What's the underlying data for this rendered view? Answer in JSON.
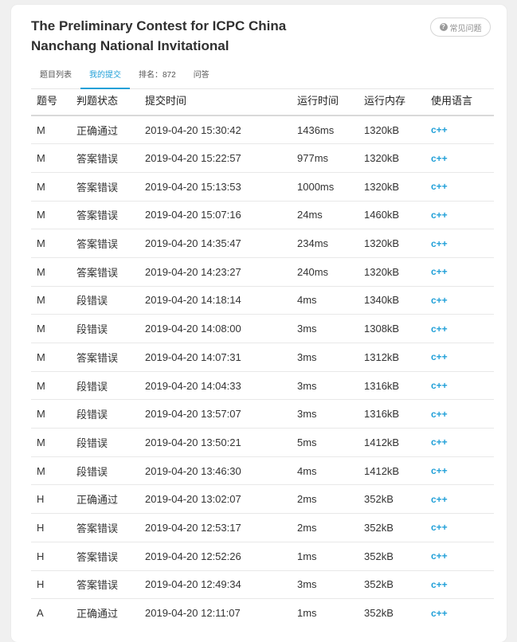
{
  "contest": {
    "title": "The Preliminary Contest for ICPC China Nanchang National Invitational",
    "faq_label": "常见问题",
    "faq_icon": "question-circle-icon"
  },
  "tabs": [
    {
      "label": "题目列表",
      "active": false
    },
    {
      "label": "我的提交",
      "active": true
    },
    {
      "label": "排名：872",
      "active": false
    },
    {
      "label": "问答",
      "active": false
    }
  ],
  "table": {
    "headers": [
      "题号",
      "判题状态",
      "提交时间",
      "运行时间",
      "运行内存",
      "使用语言"
    ],
    "rows": [
      [
        "M",
        "正确通过",
        "2019-04-20 15:30:42",
        "1436ms",
        "1320kB",
        "c++"
      ],
      [
        "M",
        "答案错误",
        "2019-04-20 15:22:57",
        "977ms",
        "1320kB",
        "c++"
      ],
      [
        "M",
        "答案错误",
        "2019-04-20 15:13:53",
        "1000ms",
        "1320kB",
        "c++"
      ],
      [
        "M",
        "答案错误",
        "2019-04-20 15:07:16",
        "24ms",
        "1460kB",
        "c++"
      ],
      [
        "M",
        "答案错误",
        "2019-04-20 14:35:47",
        "234ms",
        "1320kB",
        "c++"
      ],
      [
        "M",
        "答案错误",
        "2019-04-20 14:23:27",
        "240ms",
        "1320kB",
        "c++"
      ],
      [
        "M",
        "段错误",
        "2019-04-20 14:18:14",
        "4ms",
        "1340kB",
        "c++"
      ],
      [
        "M",
        "段错误",
        "2019-04-20 14:08:00",
        "3ms",
        "1308kB",
        "c++"
      ],
      [
        "M",
        "答案错误",
        "2019-04-20 14:07:31",
        "3ms",
        "1312kB",
        "c++"
      ],
      [
        "M",
        "段错误",
        "2019-04-20 14:04:33",
        "3ms",
        "1316kB",
        "c++"
      ],
      [
        "M",
        "段错误",
        "2019-04-20 13:57:07",
        "3ms",
        "1316kB",
        "c++"
      ],
      [
        "M",
        "段错误",
        "2019-04-20 13:50:21",
        "5ms",
        "1412kB",
        "c++"
      ],
      [
        "M",
        "段错误",
        "2019-04-20 13:46:30",
        "4ms",
        "1412kB",
        "c++"
      ],
      [
        "H",
        "正确通过",
        "2019-04-20 13:02:07",
        "2ms",
        "352kB",
        "c++"
      ],
      [
        "H",
        "答案错误",
        "2019-04-20 12:53:17",
        "2ms",
        "352kB",
        "c++"
      ],
      [
        "H",
        "答案错误",
        "2019-04-20 12:52:26",
        "1ms",
        "352kB",
        "c++"
      ],
      [
        "H",
        "答案错误",
        "2019-04-20 12:49:34",
        "3ms",
        "352kB",
        "c++"
      ],
      [
        "A",
        "正确通过",
        "2019-04-20 12:11:07",
        "1ms",
        "352kB",
        "c++"
      ]
    ]
  },
  "colors": {
    "accent": "#21a0d8",
    "background": "#f0f0f0",
    "card": "#ffffff"
  }
}
